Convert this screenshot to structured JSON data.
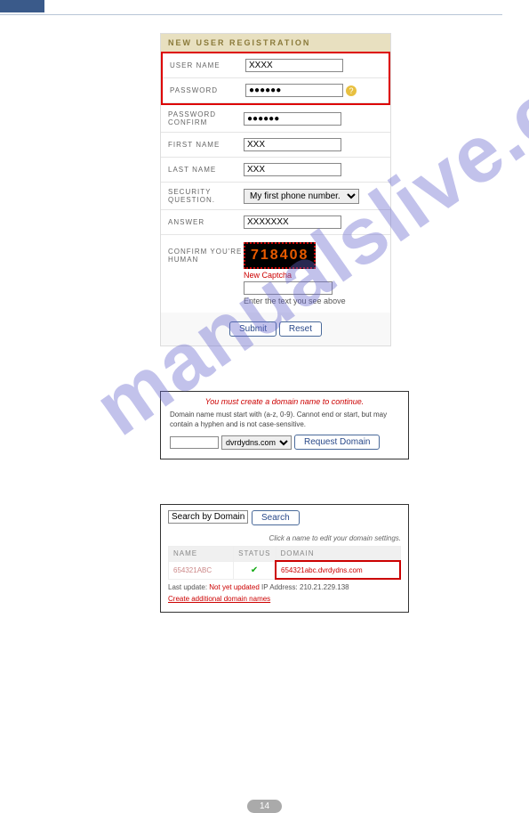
{
  "watermark": "manualslive.com",
  "registration": {
    "title": "NEW USER REGISTRATION",
    "username_label": "USER NAME",
    "username_value": "XXXX",
    "password_label": "PASSWORD",
    "password_value": "●●●●●●",
    "password_confirm_label": "PASSWORD CONFIRM",
    "password_confirm_value": "●●●●●●",
    "firstname_label": "FIRST NAME",
    "firstname_value": "XXX",
    "lastname_label": "LAST NAME",
    "lastname_value": "XXX",
    "security_q_label": "SECURITY QUESTION.",
    "security_q_value": "My first phone number.",
    "answer_label": "ANSWER",
    "answer_value": "XXXXXXX",
    "captcha_label": "CONFIRM YOU'RE HUMAN",
    "captcha_text": "718408",
    "captcha_new": "New Captcha",
    "captcha_hint": "Enter the text you see above",
    "submit": "Submit",
    "reset": "Reset"
  },
  "domain_create": {
    "warn": "You must create a domain name to continue.",
    "info": "Domain name must start with (a-z, 0-9). Cannot end or start, but may contain a hyphen and is not case-sensitive.",
    "domain_suffix": "dvrdydns.com",
    "request_btn": "Request Domain"
  },
  "domain_search": {
    "input_value": "Search by Domain",
    "search_btn": "Search",
    "hint": "Click a name to edit your domain settings.",
    "headers": {
      "name": "NAME",
      "status": "STATUS",
      "domain": "DOMAIN"
    },
    "row": {
      "name": "654321ABC",
      "status": "✔",
      "domain": "654321abc.dvrdydns.com"
    },
    "status_line_prefix": "Last update:",
    "status_line_red": "Not yet updated",
    "status_ip": "IP Address: 210.21.229.138",
    "link": "Create additional domain names"
  },
  "page_number": "14"
}
